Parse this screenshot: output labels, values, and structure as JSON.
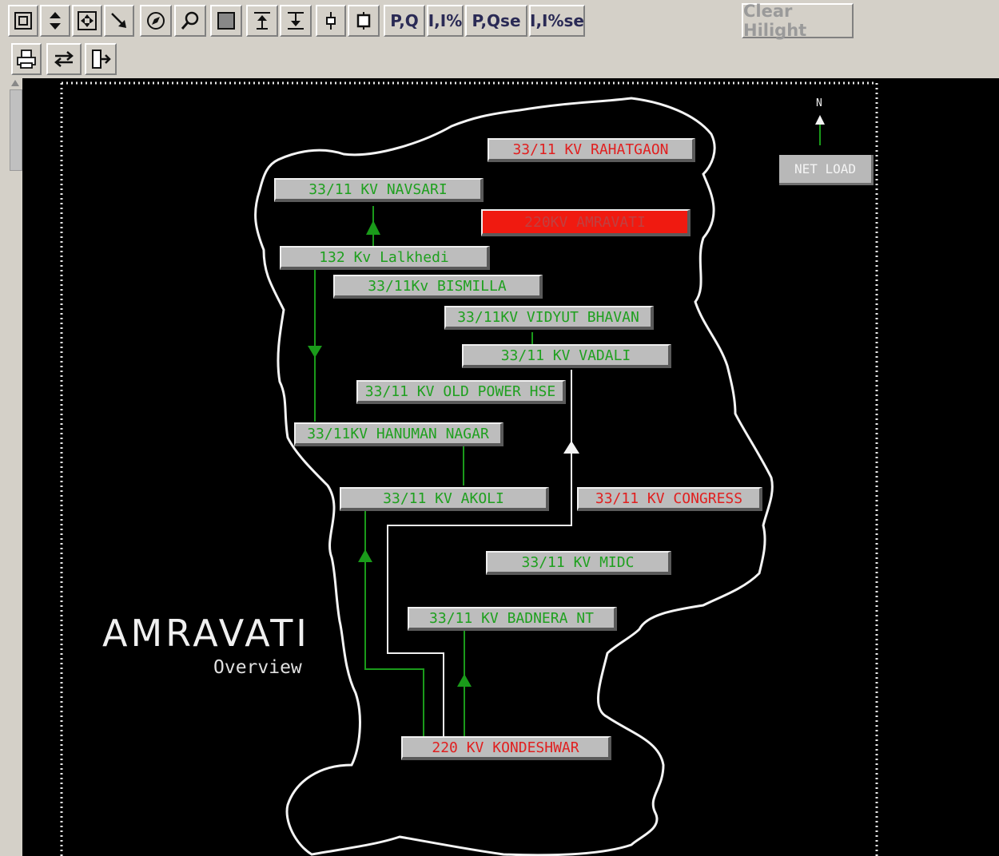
{
  "toolbar": {
    "row1": [
      {
        "id": "fit",
        "icon": "fit-window-icon"
      },
      {
        "id": "pan",
        "icon": "pan-updown-icon"
      },
      {
        "id": "zoom-extents",
        "icon": "zoom-extents-icon"
      },
      {
        "id": "pointer",
        "icon": "arrow-pointer-icon"
      },
      {
        "id": "compass",
        "icon": "compass-icon"
      },
      {
        "id": "find",
        "icon": "magnifier-icon"
      },
      {
        "id": "rect",
        "icon": "rectangle-icon"
      },
      {
        "id": "raise",
        "icon": "raise-icon"
      },
      {
        "id": "lower",
        "icon": "lower-icon"
      },
      {
        "id": "breaker",
        "icon": "breaker-icon"
      },
      {
        "id": "isolator",
        "icon": "isolator-icon"
      }
    ],
    "text_buttons": [
      "P,Q",
      "I,I%",
      "P,Qse",
      "I,I%se"
    ],
    "clear_label": "Clear Hilight",
    "row2": [
      {
        "id": "print",
        "icon": "printer-icon"
      },
      {
        "id": "swap",
        "icon": "swap-arrows-icon"
      },
      {
        "id": "exit",
        "icon": "exit-door-icon"
      }
    ]
  },
  "map": {
    "title": "AMRAVATI",
    "subtitle": "Overview",
    "north_label": "N",
    "net_load_label": "NET LOAD",
    "stations": {
      "rahatgaon": "33/11 KV RAHATGAON",
      "navsari": "33/11 KV NAVSARI",
      "amravati220": "220KV AMRAVATI",
      "lalkhedi": "132 Kv Lalkhedi",
      "bismilla": "33/11Kv BISMILLA",
      "vidyut": "33/11KV VIDYUT BHAVAN",
      "vadali": "33/11 KV  VADALI",
      "oldpower": "33/11 KV OLD POWER HSE",
      "hanuman": "33/11KV HANUMAN NAGAR",
      "akoli": "33/11 KV AKOLI",
      "congress": "33/11 KV CONGRESS",
      "midc": "33/11 KV MIDC",
      "badnera": "33/11 KV BADNERA NT",
      "kondeshwar": "220 KV KONDESHWAR"
    },
    "colors": {
      "normal": "#1fa01f",
      "warning": "#e02020",
      "alarm_bg": "#f01a10"
    }
  }
}
